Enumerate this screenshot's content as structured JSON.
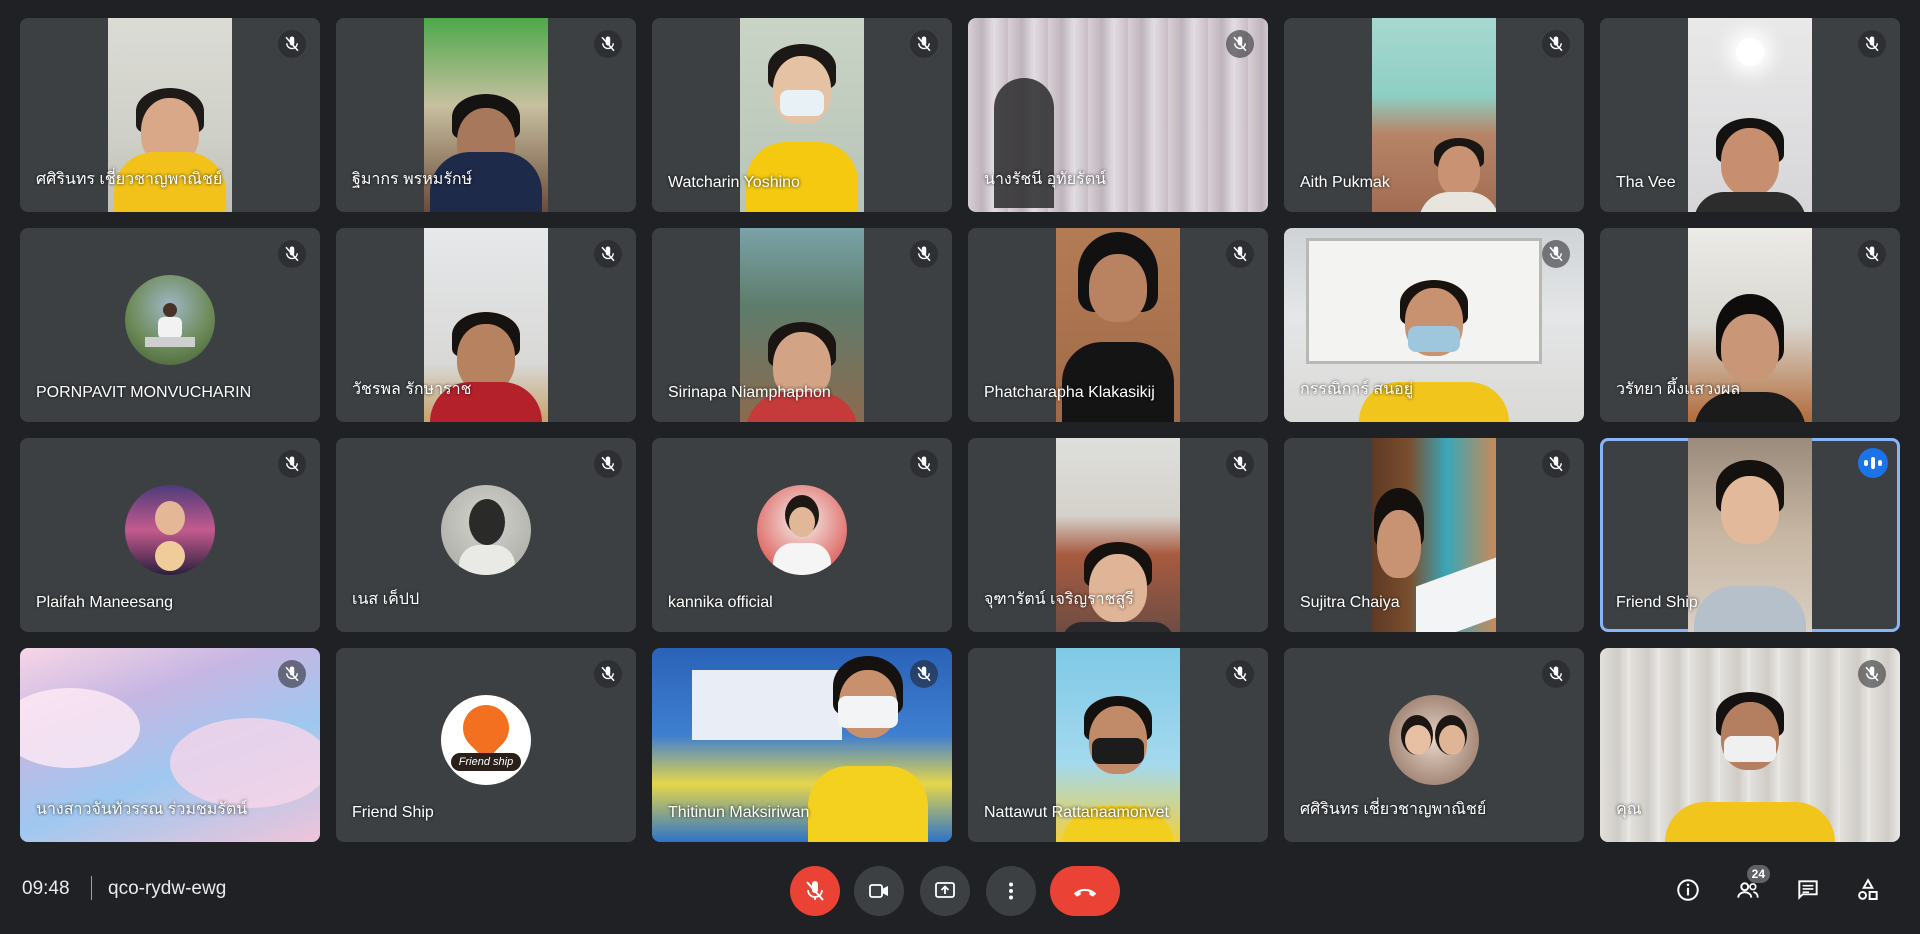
{
  "meeting": {
    "time": "09:48",
    "code": "qco-rydw-ewg",
    "participants_count": "24"
  },
  "participants": [
    "ศศิรินทร เชี่ยวชาญพาณิชย์",
    "ฐิมากร พรหมรักษ์",
    "Watcharin Yoshino",
    "นางรัชนี อุทัยรัตน์",
    "Aith Pukmak",
    "Tha Vee",
    "PORNPAVIT MONVUCHARIN",
    "วัชรพล รักษาราช",
    "Sirinapa Niamphaphon",
    "Phatcharapha Klakasikij",
    "กรรณิการ์ สนอยู่",
    "วรัทยา ผึ้งแสวงผล",
    "Plaifah Maneesang",
    "เนส เค็ปป",
    "kannika official",
    "จุฑารัตน์ เจริญราชสูรี",
    "Sujitra Chaiya",
    "Friend Ship",
    "นางสาวจันทัวรรณ ร่วมชมรัตน์",
    "Friend Ship",
    "Thitinun Maksiriwan",
    "Nattawut Rattanaamonvet",
    "ศศิรินทร เชี่ยวชาญพาณิชย์",
    "คุณ"
  ],
  "avatar_text": "Friend ship",
  "colors": {
    "background": "#202124",
    "tile": "#3c4043",
    "speaking_outline": "#8ab4f8",
    "end_call": "#ea4335",
    "speaking_indicator": "#1a73e8"
  },
  "icons": {
    "tile": "mic-off-icon",
    "speaking": "audio-level-icon",
    "controls": [
      "mic-off-icon",
      "camera-icon",
      "present-icon",
      "more-options-icon",
      "end-call-icon"
    ],
    "right": [
      "info-icon",
      "people-icon",
      "chat-icon",
      "activities-icon"
    ]
  }
}
